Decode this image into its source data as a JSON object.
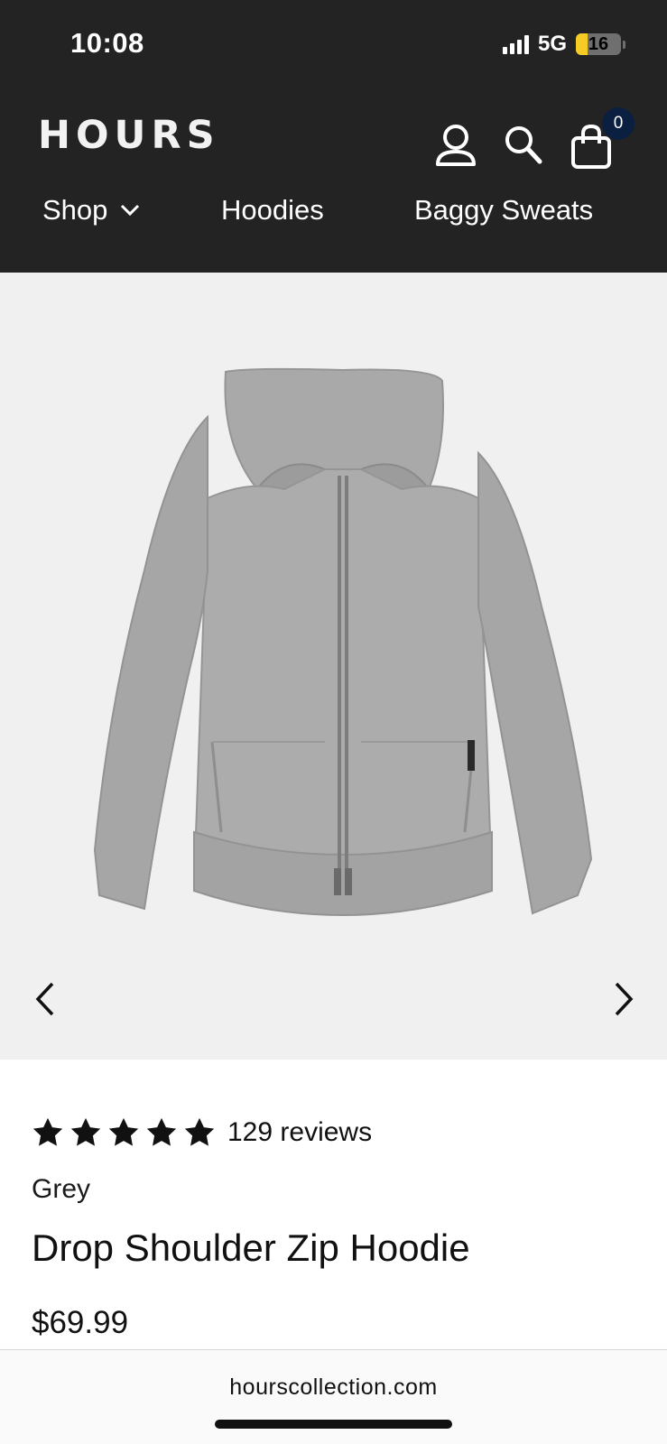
{
  "status_bar": {
    "time": "10:08",
    "network": "5G",
    "battery_level": "16",
    "battery_fraction": 0.16
  },
  "header": {
    "brand": "HOURS",
    "cart_count": "0",
    "icons": [
      "account-icon",
      "search-icon",
      "shopping-bag-icon"
    ]
  },
  "nav": {
    "items": [
      {
        "label": "Shop",
        "has_dropdown": true
      },
      {
        "label": "Hoodies"
      },
      {
        "label": "Baggy Sweats"
      }
    ]
  },
  "product": {
    "rating_stars": 5,
    "reviews_text": "129 reviews",
    "variant": "Grey",
    "title": "Drop Shoulder Zip Hoodie",
    "price": "$69.99",
    "image_color": "#a9a9a9"
  },
  "browser": {
    "url": "hourscollection.com"
  },
  "colors": {
    "header_bg": "#232323",
    "badge_bg": "#0b2041",
    "gallery_bg": "#f0f0f0",
    "battery_fill": "#f5cc25"
  }
}
